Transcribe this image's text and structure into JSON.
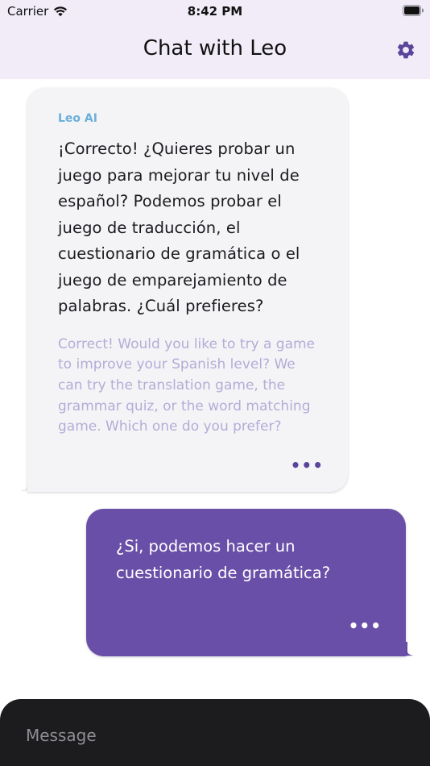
{
  "status_bar": {
    "carrier": "Carrier",
    "time": "8:42 PM"
  },
  "header": {
    "title": "Chat with Leo",
    "settings_icon": "gear-icon"
  },
  "messages": [
    {
      "sender": "Leo AI",
      "text": "¡Correcto! ¿Quieres probar un juego para mejorar tu nivel de español? Podemos probar el juego de traducción, el cuestionario de gramática o el juego de emparejamiento de palabras. ¿Cuál prefieres?",
      "translation": "Correct! Would you like to try a game to improve your Spanish level? We can try the translation game, the grammar quiz, or the word matching game. Which one do you prefer?",
      "more": "•••"
    },
    {
      "text": "¿Si, podemos hacer un cuestionario de gramática?",
      "more": "•••"
    }
  ],
  "input": {
    "placeholder": "Message",
    "value": ""
  },
  "colors": {
    "header_bg": "#f1ecf8",
    "ai_bubble": "#f4f4f7",
    "user_bubble": "#6a4fa8",
    "sender_label": "#6bb0d9",
    "translation_text": "#b4acd6",
    "input_bar": "#1c1c1f"
  }
}
